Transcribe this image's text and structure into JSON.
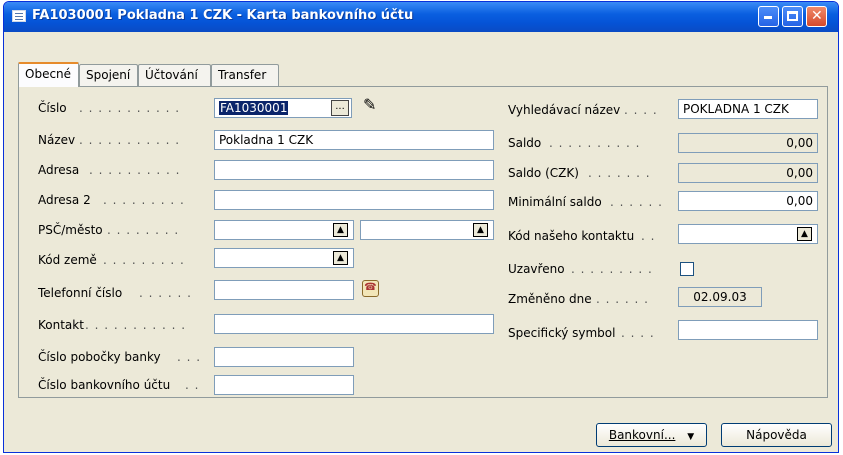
{
  "window": {
    "title": "FA1030001 Pokladna 1 CZK - Karta bankovního účtu"
  },
  "tabs": [
    "Obecné",
    "Spojení",
    "Účtování",
    "Transfer"
  ],
  "left": {
    "cislo": {
      "label": "Číslo",
      "value": "FA1030001"
    },
    "nazev": {
      "label": "Název",
      "value": "Pokladna 1 CZK"
    },
    "adresa": {
      "label": "Adresa",
      "value": ""
    },
    "adresa2": {
      "label": "Adresa 2",
      "value": ""
    },
    "psc": {
      "label": "PSČ/město",
      "value": "",
      "city": ""
    },
    "kod_zeme": {
      "label": "Kód země",
      "value": ""
    },
    "telefon": {
      "label": "Telefonní číslo",
      "value": ""
    },
    "kontakt": {
      "label": "Kontakt",
      "value": ""
    },
    "cislo_pobocky": {
      "label": "Číslo pobočky banky",
      "value": ""
    },
    "cislo_uctu": {
      "label": "Číslo bankovního účtu",
      "value": ""
    }
  },
  "right": {
    "vyhledavaci": {
      "label": "Vyhledávací název",
      "value": "POKLADNA 1 CZK"
    },
    "saldo": {
      "label": "Saldo",
      "value": "0,00"
    },
    "saldo_czk": {
      "label": "Saldo (CZK)",
      "value": "0,00"
    },
    "min_saldo": {
      "label": "Minimální saldo",
      "value": "0,00"
    },
    "kod_kontaktu": {
      "label": "Kód našeho kontaktu",
      "value": ""
    },
    "uzavreno": {
      "label": "Uzavřeno",
      "checked": false
    },
    "zmeneno": {
      "label": "Změněno dne",
      "value": "02.09.03"
    },
    "spec_symbol": {
      "label": "Specifický symbol",
      "value": ""
    }
  },
  "buttons": {
    "bankovni": "Bankovní...",
    "napoveda": "Nápověda"
  },
  "icons": {
    "app": "form-icon",
    "edit": "pencil-icon",
    "phone": "phone-dial-icon",
    "lookup": "lookup-arrow-icon",
    "ellipsis": "ellipsis-icon"
  }
}
